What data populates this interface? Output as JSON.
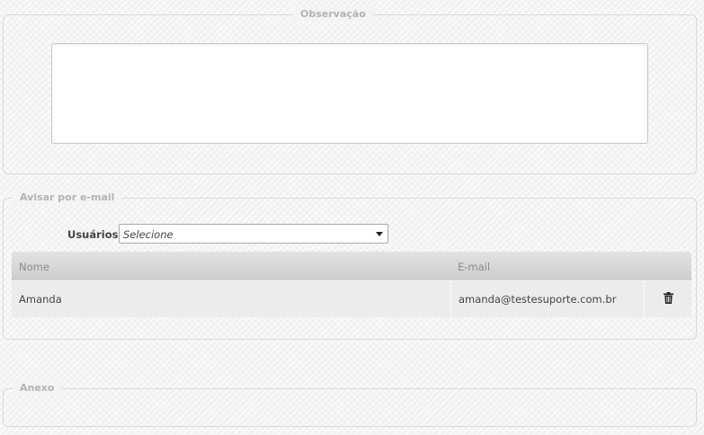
{
  "observacao": {
    "legend": "Observação",
    "textarea_value": ""
  },
  "email": {
    "legend": "Avisar por e-mail",
    "usuarios_label": "Usuários",
    "usuarios_select_value": "Selecione",
    "table": {
      "headers": {
        "nome": "Nome",
        "email": "E-mail"
      },
      "rows": [
        {
          "nome": "Amanda",
          "email": "amanda@testesuporte.com.br",
          "action_icon": "trash-icon"
        }
      ]
    }
  },
  "anexo": {
    "legend": "Anexo"
  }
}
